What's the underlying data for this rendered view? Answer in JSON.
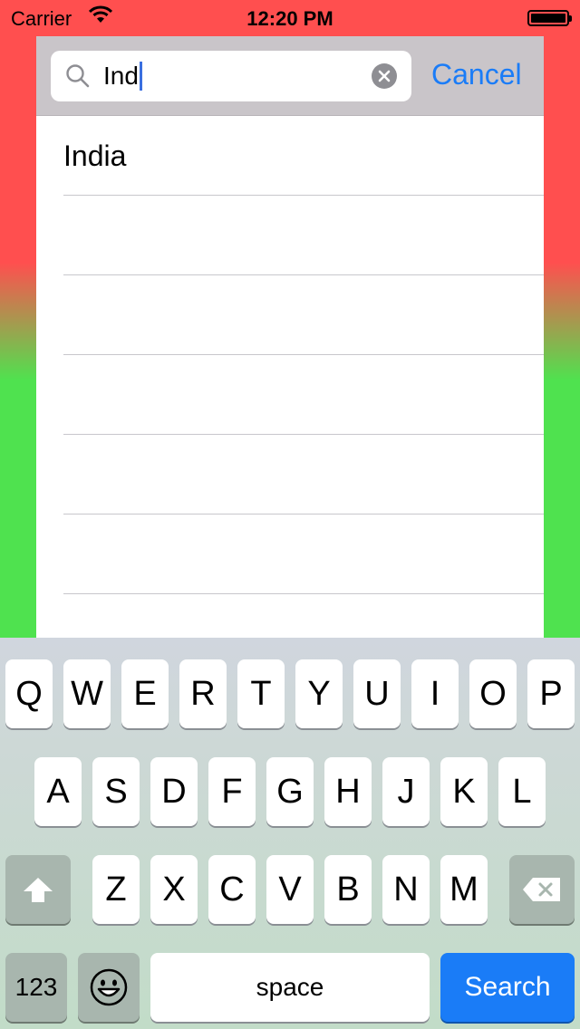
{
  "status_bar": {
    "carrier": "Carrier",
    "time": "12:20 PM",
    "wifi_icon": "wifi-icon",
    "battery_icon": "battery-icon"
  },
  "search": {
    "query": "Ind",
    "cancel_label": "Cancel",
    "search_icon": "magnifier-icon",
    "clear_icon": "clear-x-icon"
  },
  "results": {
    "rows": [
      "India",
      "",
      "",
      "",
      "",
      "",
      ""
    ]
  },
  "keyboard": {
    "row1": [
      "Q",
      "W",
      "E",
      "R",
      "T",
      "Y",
      "U",
      "I",
      "O",
      "P"
    ],
    "row2": [
      "A",
      "S",
      "D",
      "F",
      "G",
      "H",
      "J",
      "K",
      "L"
    ],
    "row3": [
      "Z",
      "X",
      "C",
      "V",
      "B",
      "N",
      "M"
    ],
    "numbers_label": "123",
    "space_label": "space",
    "search_label": "Search",
    "shift_icon": "shift-icon",
    "delete_icon": "delete-icon",
    "emoji_icon": "emoji-icon"
  },
  "colors": {
    "accent": "#1a7cf7",
    "background_top": "#ff4f4f",
    "background_bottom": "#4fe24f"
  }
}
